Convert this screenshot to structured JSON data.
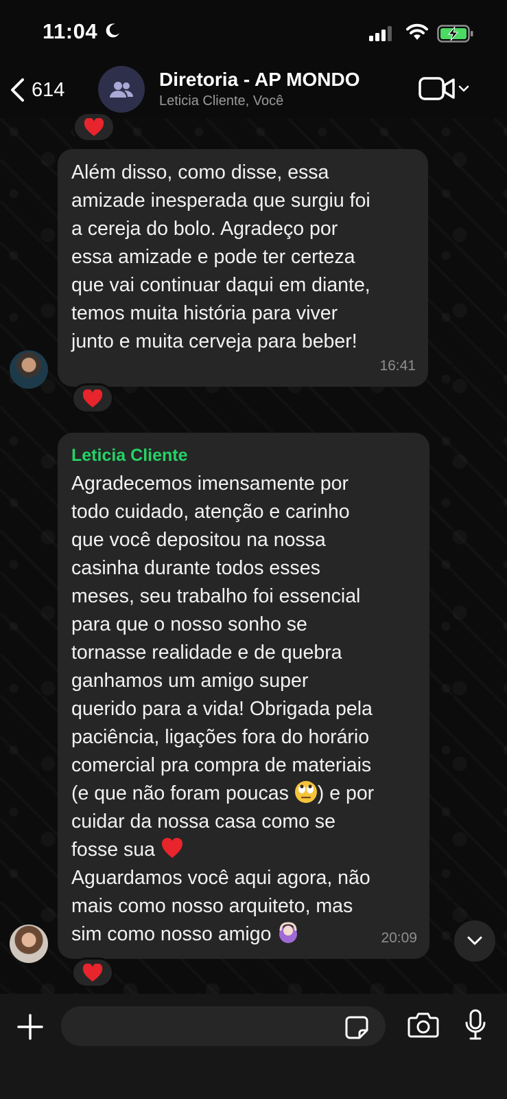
{
  "status_bar": {
    "time": "11:04",
    "battery_color": "#4cd964"
  },
  "header": {
    "back_count": "614",
    "title": "Diretoria - AP MONDO",
    "subtitle": "Leticia Cliente, Você"
  },
  "messages": [
    {
      "text": "Além disso, como disse, essa\namizade inesperada que surgiu foi\na cereja do bolo. Agradeço por\nessa amizade e pode ter certeza\nque vai continuar daqui em diante,\ntemos muita história para viver\njunto e muita cerveja para beber!",
      "time": "16:41",
      "reaction": "heart"
    },
    {
      "sender": "Leticia Cliente",
      "text_part1": "Agradecemos imensamente por\ntodo cuidado, atenção e carinho\nque você depositou na nossa\ncasinha durante todos esses\nmeses, seu trabalho foi essencial\npara que o nosso sonho se\ntornasse realidade e de quebra\nganhamos um amigo super\nquerido para a vida! Obrigada pela\npaciência, ligações fora do horário\ncomercial pra compra de materiais\n(e que não foram poucas ",
      "text_part2": ") e por\ncuidar da nossa casa como se\nfosse sua ",
      "text_part3": "\nAguardamos você aqui agora, não\nmais como nosso arquiteto, mas\nsim como nosso amigo ",
      "emojis": [
        "eye-roll-emoji",
        "red-heart-emoji",
        "person-gesturing-ok-emoji"
      ],
      "time": "20:09",
      "reaction": "heart"
    }
  ],
  "composer": {
    "placeholder": ""
  },
  "colors": {
    "sender_name": "#25d366",
    "bubble": "#262626",
    "background": "#0b0b0b"
  }
}
